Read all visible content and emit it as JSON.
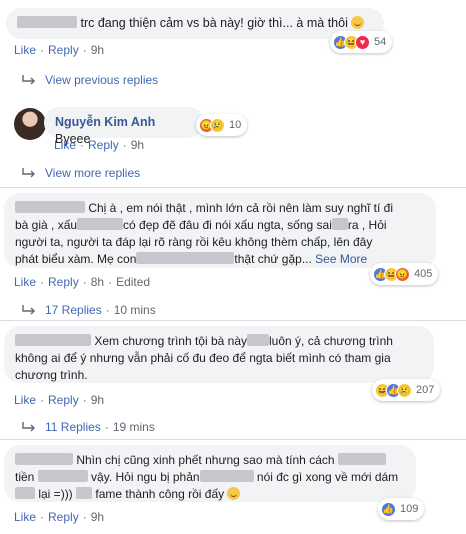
{
  "comment1": {
    "text": "trc đang thiện cảm vs bà này! giờ thì... à mà thôi",
    "like": "Like",
    "reply": "Reply",
    "time": "9h",
    "reaction_count": "54"
  },
  "view_previous": "View previous replies",
  "reply_kim": {
    "name": "Nguyễn Kim Anh",
    "text": "Byeee",
    "like": "Like",
    "reply": "Reply",
    "time": "9h",
    "reaction_count": "10"
  },
  "view_more": "View more replies",
  "comment2": {
    "lines": [
      "Chị à , em nói thật , mình lớn cả rồi nên làm suy nghĩ tí đi",
      "bà già , xấu",
      "có đẹp đẽ đâu đi nói xấu ngta, sống sai",
      "ra , Hỏi",
      "người ta, người ta đáp lại rõ ràng rồi kêu không thèm chấp, lên đây",
      "phát biểu xàm. Mẹ con",
      "thật chứ gặp...",
      "See More"
    ],
    "like": "Like",
    "reply": "Reply",
    "time": "8h",
    "edited": "Edited",
    "reaction_count": "405",
    "replies": "17 Replies",
    "replies_time": "10 mins"
  },
  "comment3": {
    "lines": [
      "Xem chương trình tội bà này",
      "luôn ý, cả chương trình",
      "không ai để ý nhưng vẫn phải cố đu đeo để ngta biết mình có tham gia",
      "chương trình."
    ],
    "like": "Like",
    "reply": "Reply",
    "time": "9h",
    "reaction_count": "207",
    "replies": "11 Replies",
    "replies_time": "19 mins"
  },
  "comment4": {
    "lines": [
      "Nhìn chị cũng xinh phết nhưng sao mà tính cách",
      "tiền",
      "vậy. Hỏi ngu bị phản",
      "nói đc gì xong về mới dám",
      "lại =)))",
      "fame thành công rồi đấy"
    ],
    "like": "Like",
    "reply": "Reply",
    "time": "9h",
    "reaction_count": "109"
  },
  "icons": [
    "like-reaction-icon",
    "haha-reaction-icon",
    "love-reaction-icon",
    "sad-reaction-icon",
    "angry-reaction-icon",
    "reply-arrow-icon",
    "smile-emoji-icon"
  ]
}
